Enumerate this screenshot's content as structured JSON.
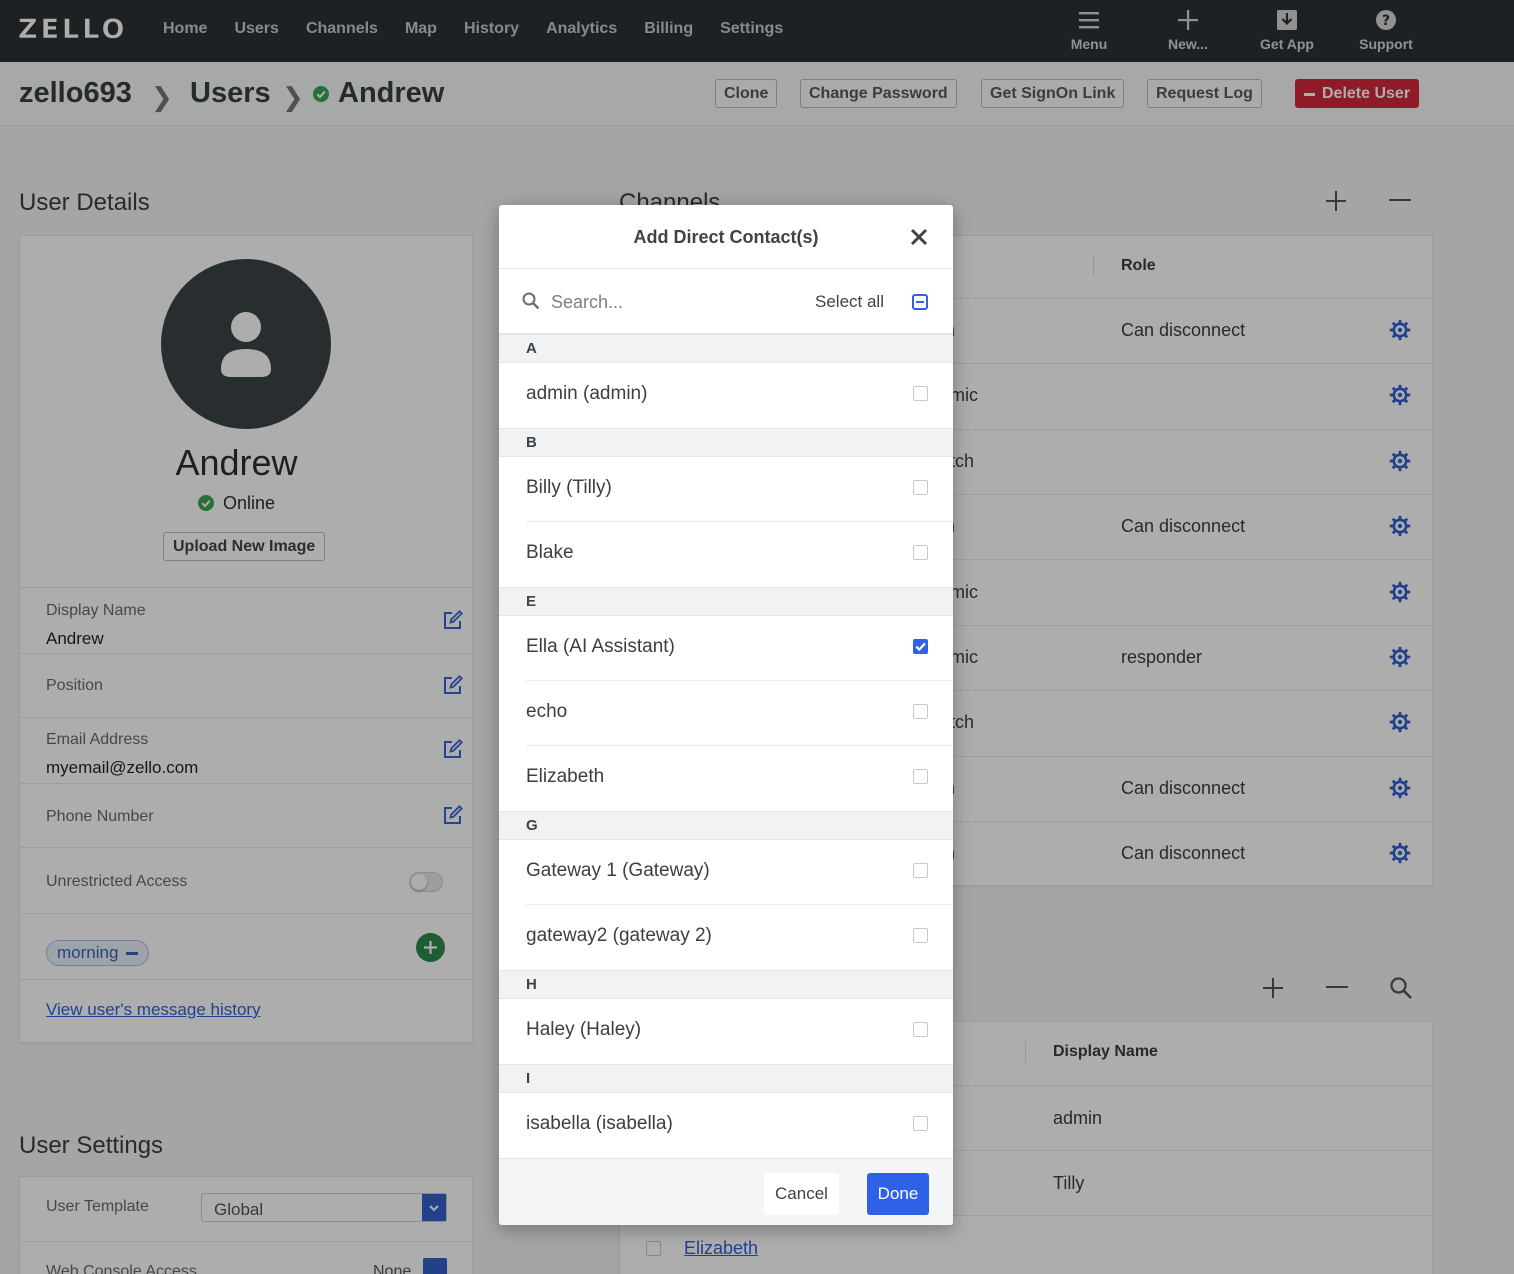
{
  "app": {
    "logo": "ZELLO",
    "nav": [
      "Home",
      "Users",
      "Channels",
      "Map",
      "History",
      "Analytics",
      "Billing",
      "Settings"
    ],
    "tools": [
      {
        "label": "Menu",
        "icon": "hamburger-icon"
      },
      {
        "label": "New...",
        "icon": "plus-icon"
      },
      {
        "label": "Get App",
        "icon": "download-icon"
      },
      {
        "label": "Support",
        "icon": "question-icon"
      }
    ]
  },
  "breadcrumb": {
    "network": "zello693",
    "section": "Users",
    "user": "Andrew"
  },
  "header_actions": {
    "clone": "Clone",
    "change_password": "Change Password",
    "signon_link": "Get SignOn Link",
    "request_log": "Request Log",
    "delete": "Delete User"
  },
  "user_details": {
    "title": "User Details",
    "name": "Andrew",
    "status": "Online",
    "upload_label": "Upload New Image",
    "fields": [
      {
        "label": "Display Name",
        "value": "Andrew"
      },
      {
        "label": "Position",
        "value": ""
      },
      {
        "label": "Email Address",
        "value": "myemail@zello.com"
      },
      {
        "label": "Phone Number",
        "value": ""
      }
    ],
    "unrestricted_label": "Unrestricted Access",
    "unrestricted_on": false,
    "tag": "morning",
    "history_link": "View user's message history"
  },
  "user_settings": {
    "title": "User Settings",
    "template_label": "User Template",
    "template_value": "Global",
    "console_label": "Web Console Access",
    "console_value": "None"
  },
  "channels": {
    "title": "Channels",
    "col_role": "Role",
    "rows": [
      {
        "frag": "m",
        "role": "Can disconnect"
      },
      {
        "frag": "amic",
        "role": ""
      },
      {
        "frag": "atch",
        "role": ""
      },
      {
        "frag": "m",
        "role": "Can disconnect"
      },
      {
        "frag": "amic",
        "role": ""
      },
      {
        "frag": "amic",
        "role": "responder"
      },
      {
        "frag": "atch",
        "role": ""
      },
      {
        "frag": "m",
        "role": "Can disconnect"
      },
      {
        "frag": "m",
        "role": "Can disconnect"
      }
    ]
  },
  "contacts": {
    "col_display": "Display Name",
    "rows": [
      "admin",
      "Tilly"
    ],
    "last_link": "Elizabeth"
  },
  "modal": {
    "title": "Add Direct Contact(s)",
    "search_placeholder": "Search...",
    "select_all": "Select all",
    "groups": [
      {
        "letter": "A",
        "items": [
          {
            "name": "admin (admin)",
            "checked": false
          }
        ]
      },
      {
        "letter": "B",
        "items": [
          {
            "name": "Billy (Tilly)",
            "checked": false
          },
          {
            "name": "Blake",
            "checked": false
          }
        ]
      },
      {
        "letter": "E",
        "items": [
          {
            "name": "Ella (AI Assistant)",
            "checked": true
          },
          {
            "name": "echo",
            "checked": false
          },
          {
            "name": "Elizabeth",
            "checked": false
          }
        ]
      },
      {
        "letter": "G",
        "items": [
          {
            "name": "Gateway 1 (Gateway)",
            "checked": false
          },
          {
            "name": "gateway2 (gateway 2)",
            "checked": false
          }
        ]
      },
      {
        "letter": "H",
        "items": [
          {
            "name": "Haley (Haley)",
            "checked": false
          }
        ]
      },
      {
        "letter": "I",
        "items": [
          {
            "name": "isabella (isabella)",
            "checked": false
          }
        ]
      }
    ],
    "cancel": "Cancel",
    "done": "Done"
  },
  "colors": {
    "accent": "#2f61e8",
    "danger": "#d4283c",
    "online": "#3aa655",
    "topbar": "#2d3234"
  }
}
